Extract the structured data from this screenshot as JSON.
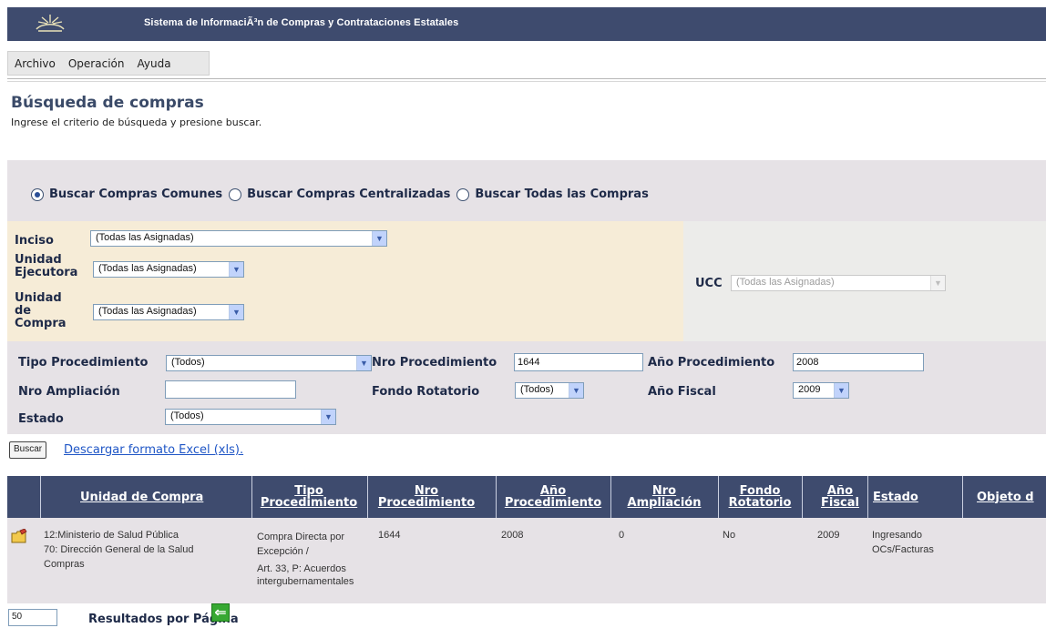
{
  "header": {
    "system_title": "Sistema de InformaciÃ³n de Compras y Contrataciones Estatales"
  },
  "menu": {
    "items": [
      {
        "label": "Archivo"
      },
      {
        "label": "Operación"
      },
      {
        "label": "Ayuda"
      }
    ]
  },
  "page": {
    "title": "Búsqueda de compras",
    "subtitle": "Ingrese el criterio de búsqueda y presione buscar."
  },
  "search_scope": {
    "options": [
      {
        "label": "Buscar Compras Comunes",
        "selected": true
      },
      {
        "label": "Buscar Compras Centralizadas",
        "selected": false
      },
      {
        "label": "Buscar Todas las Compras",
        "selected": false
      }
    ]
  },
  "org_filters": {
    "inciso_label": "Inciso",
    "inciso_value": "(Todas las Asignadas)",
    "unidad_ejecutora_label_1": "Unidad",
    "unidad_ejecutora_label_2": "Ejecutora",
    "unidad_ejecutora_value": "(Todas las Asignadas)",
    "unidad_compra_label_1": "Unidad",
    "unidad_compra_label_2": "de",
    "unidad_compra_label_3": "Compra",
    "unidad_compra_value": "(Todas las Asignadas)",
    "ucc_label": "UCC",
    "ucc_value": "(Todas las Asignadas)"
  },
  "filters": {
    "tipo_procedimiento_label": "Tipo Procedimiento",
    "tipo_procedimiento_value": "(Todos)",
    "nro_procedimiento_label": "Nro Procedimiento",
    "nro_procedimiento_value": "1644",
    "anio_procedimiento_label": "Año Procedimiento",
    "anio_procedimiento_value": "2008",
    "nro_ampliacion_label": "Nro Ampliación",
    "nro_ampliacion_value": "",
    "fondo_rotatorio_label": "Fondo Rotatorio",
    "fondo_rotatorio_value": "(Todos)",
    "anio_fiscal_label": "Año Fiscal",
    "anio_fiscal_value": "2009",
    "estado_label": "Estado",
    "estado_value": "(Todos)"
  },
  "actions": {
    "buscar_label": "Buscar",
    "excel_link": "Descargar formato Excel (xls)."
  },
  "results": {
    "columns": {
      "unidad_compra": "Unidad de Compra",
      "tipo_1": "Tipo",
      "tipo_2": "Procedimiento",
      "nro_proc_1": "Nro",
      "nro_proc_2": "Procedimiento",
      "anio_proc_1": "Año",
      "anio_proc_2": "Procedimiento",
      "nro_amp_1": "Nro",
      "nro_amp_2": "Ampliación",
      "fondo_1": "Fondo",
      "fondo_2": "Rotatorio",
      "anio_fiscal_1": "Año",
      "anio_fiscal_2": "Fiscal",
      "estado": "Estado",
      "objeto": "Objeto d"
    },
    "row": {
      "unidad_line1": "12:Ministerio de Salud Pública",
      "unidad_line2": "70: Dirección General de la Salud",
      "unidad_line3": "Compras",
      "tipo_line1": "Compra Directa por",
      "tipo_line2": "Excepción /",
      "tipo_line3": "Art. 33, P: Acuerdos",
      "tipo_line4": "intergubernamentales",
      "nro_procedimiento": "1644",
      "anio_procedimiento": "2008",
      "nro_ampliacion": "0",
      "fondo_rotatorio": "No",
      "anio_fiscal": "2009",
      "estado_line1": "Ingresando",
      "estado_line2": "OCs/Facturas",
      "icon": "edit-folder-icon"
    }
  },
  "pagination": {
    "per_page_value": "50",
    "per_page_label": "Resultados por Página"
  },
  "colors": {
    "header_bg": "#3e4b6e",
    "filter_bg": "#e6e2e6",
    "inciso_bg": "#f6ecd7",
    "link": "#1f56c6"
  }
}
